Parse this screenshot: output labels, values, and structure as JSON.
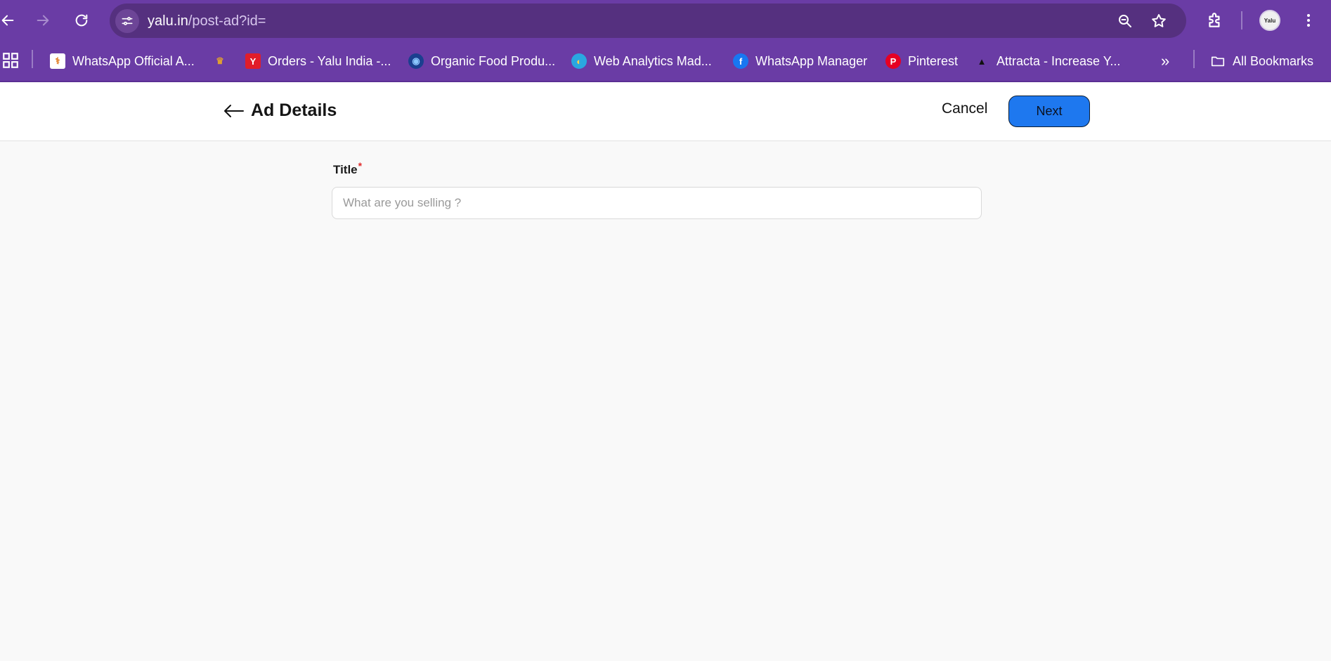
{
  "browser": {
    "url_domain": "yalu.in",
    "url_path": "/post-ad?id=",
    "icons": [
      "back-icon",
      "forward-icon",
      "reload-icon",
      "site-info-icon",
      "zoom-icon",
      "star-icon",
      "extensions-icon",
      "avatar",
      "menu-icon"
    ],
    "avatar_text": "Yalu"
  },
  "bookmarks": {
    "items": [
      {
        "label": "WhatsApp Official A...",
        "icon": "bookmark-favicon"
      },
      {
        "label": "",
        "icon": "bookmark-favicon"
      },
      {
        "label": "Orders - Yalu India -...",
        "icon": "yalu-favicon"
      },
      {
        "label": "Organic Food Produ...",
        "icon": "globe-favicon"
      },
      {
        "label": "Web Analytics Mad...",
        "icon": "analytics-favicon"
      },
      {
        "label": "WhatsApp Manager",
        "icon": "facebook-favicon"
      },
      {
        "label": "Pinterest",
        "icon": "pinterest-favicon"
      },
      {
        "label": "Attracta - Increase Y...",
        "icon": "attracta-favicon"
      }
    ],
    "overflow": "»",
    "all_bookmarks": "All Bookmarks"
  },
  "header": {
    "title": "Ad Details",
    "cancel_label": "Cancel",
    "next_label": "Next"
  },
  "form": {
    "title_label": "Title",
    "required_mark": "*",
    "title_placeholder": "What are you selling ?",
    "title_value": ""
  },
  "colors": {
    "browser_bar": "#6a3ca5",
    "omnibox": "#55307f",
    "primary_button": "#1e78ef",
    "required": "#e02b2b"
  }
}
